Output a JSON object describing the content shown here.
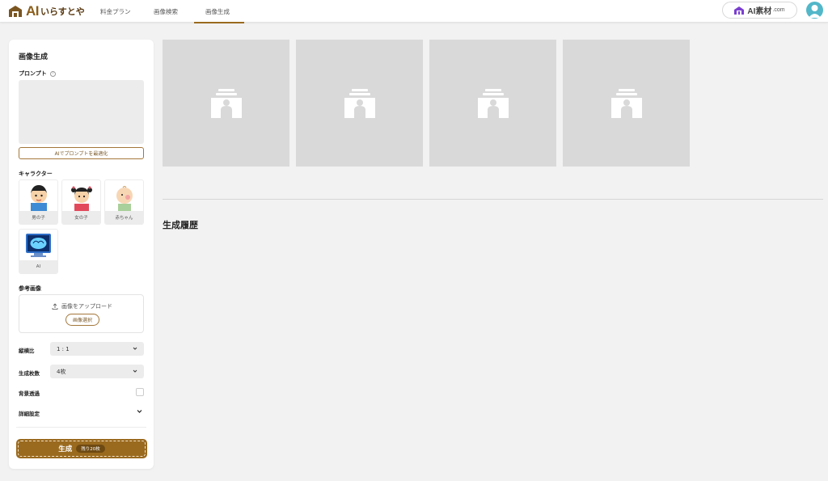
{
  "header": {
    "logo_ai": "AI",
    "logo_jp": "いらすとや",
    "nav": [
      {
        "label": "料金プラン"
      },
      {
        "label": "画像検索"
      },
      {
        "label": "画像生成",
        "active": true
      }
    ],
    "ai_sozai": {
      "main": "AI素材",
      "suffix": ".com"
    },
    "accent_color": "#9a6a1e"
  },
  "sidebar": {
    "title": "画像生成",
    "prompt_label": "プロンプト",
    "prompt_value": "",
    "optimize_button": "AIでプロンプトを最適化",
    "character_label": "キャラクター",
    "characters": [
      {
        "name": "男の子"
      },
      {
        "name": "女の子"
      },
      {
        "name": "赤ちゃん"
      },
      {
        "name": "AI"
      }
    ],
    "reference_label": "参考画像",
    "upload_text": "画像をアップロード",
    "select_image_button": "画像選択",
    "aspect_label": "縦横比",
    "aspect_value": "1 : 1",
    "count_label": "生成枚数",
    "count_value": "4枚",
    "transparent_label": "背景透過",
    "transparent_checked": false,
    "advanced_label": "詳細設定",
    "generate_button": "生成",
    "remaining": "残り20枚"
  },
  "main": {
    "placeholders": 4,
    "history_title": "生成履歴"
  }
}
